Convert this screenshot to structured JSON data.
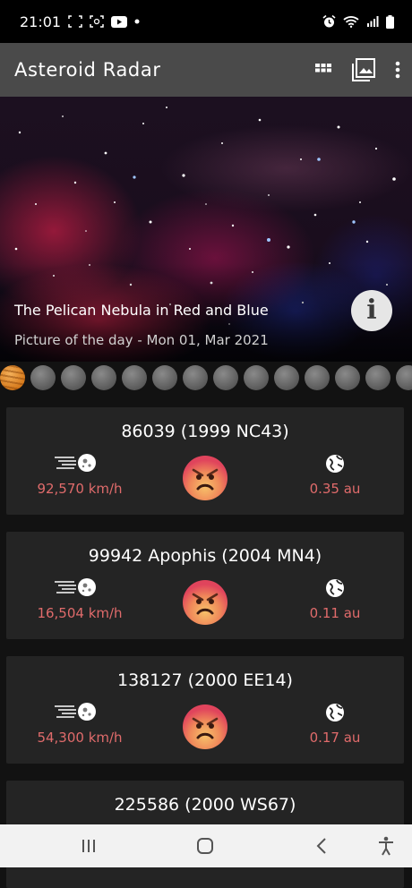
{
  "status_bar": {
    "time": "21:01"
  },
  "app": {
    "title": "Asteroid Radar",
    "actions": [
      {
        "name": "grid-view",
        "icon": "grid-icon"
      },
      {
        "name": "gallery",
        "icon": "image-icon"
      },
      {
        "name": "overflow-menu",
        "icon": "more-vert-icon"
      }
    ]
  },
  "picture_of_day": {
    "title": "The Pelican Nebula in Red and Blue",
    "subtitle": "Picture of the day - Mon 01, Mar 2021",
    "info_icon": "info-icon"
  },
  "pager": {
    "count": 14,
    "active_index": 0
  },
  "colors": {
    "accent_red": "#e06b6b",
    "card_bg": "#242424",
    "app_bar": "#4a4a4a"
  },
  "asteroids": [
    {
      "name": "86039 (1999 NC43)",
      "speed": "92,570 km/h",
      "distance": "0.35 au",
      "hazard_icon": "angry-face-icon"
    },
    {
      "name": "99942 Apophis (2004 MN4)",
      "speed": "16,504 km/h",
      "distance": "0.11 au",
      "hazard_icon": "angry-face-icon"
    },
    {
      "name": "138127 (2000 EE14)",
      "speed": "54,300 km/h",
      "distance": "0.17 au",
      "hazard_icon": "angry-face-icon"
    },
    {
      "name": "225586 (2000 WS67)",
      "speed": "",
      "distance": "",
      "hazard_icon": ""
    }
  ]
}
